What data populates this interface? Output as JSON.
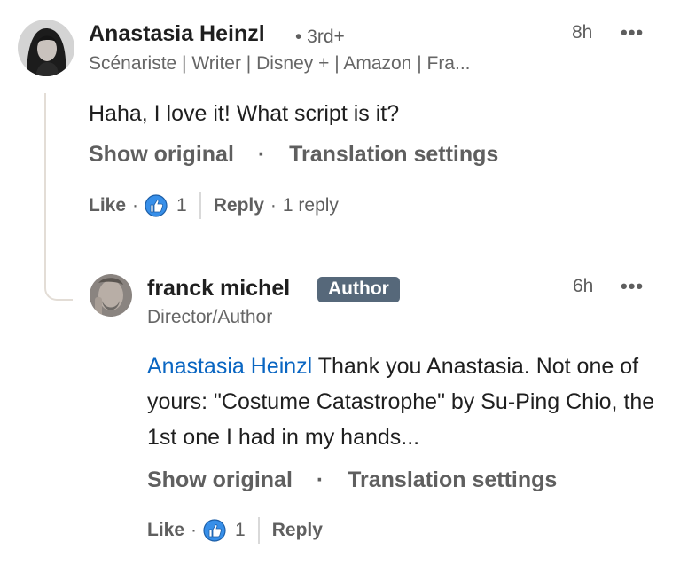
{
  "comment1": {
    "author": "Anastasia Heinzl",
    "degree": "• 3rd+",
    "headline": "Scénariste | Writer | Disney + | Amazon | Fra...",
    "time": "8h",
    "more": "•••",
    "text": "Haha, I love it! What script is it?",
    "show_original": "Show original",
    "dot": "·",
    "translation_settings": "Translation settings",
    "like": "Like",
    "reaction_count": "1",
    "reply": "Reply",
    "replies": "1 reply"
  },
  "reply1": {
    "author": "franck michel",
    "badge": "Author",
    "headline": "Director/Author",
    "time": "6h",
    "more": "•••",
    "mention": "Anastasia Heinzl",
    "text": " Thank you Anastasia. Not one of yours: \"Costume Catastrophe\" by Su-Ping Chio, the 1st one I had in my hands...",
    "show_original": "Show original",
    "dot": "·",
    "translation_settings": "Translation settings",
    "like": "Like",
    "reaction_count": "1",
    "reply": "Reply"
  },
  "colors": {
    "mention": "#0a66c2",
    "like_icon": "#378fe9",
    "author_badge": "#56687a"
  }
}
